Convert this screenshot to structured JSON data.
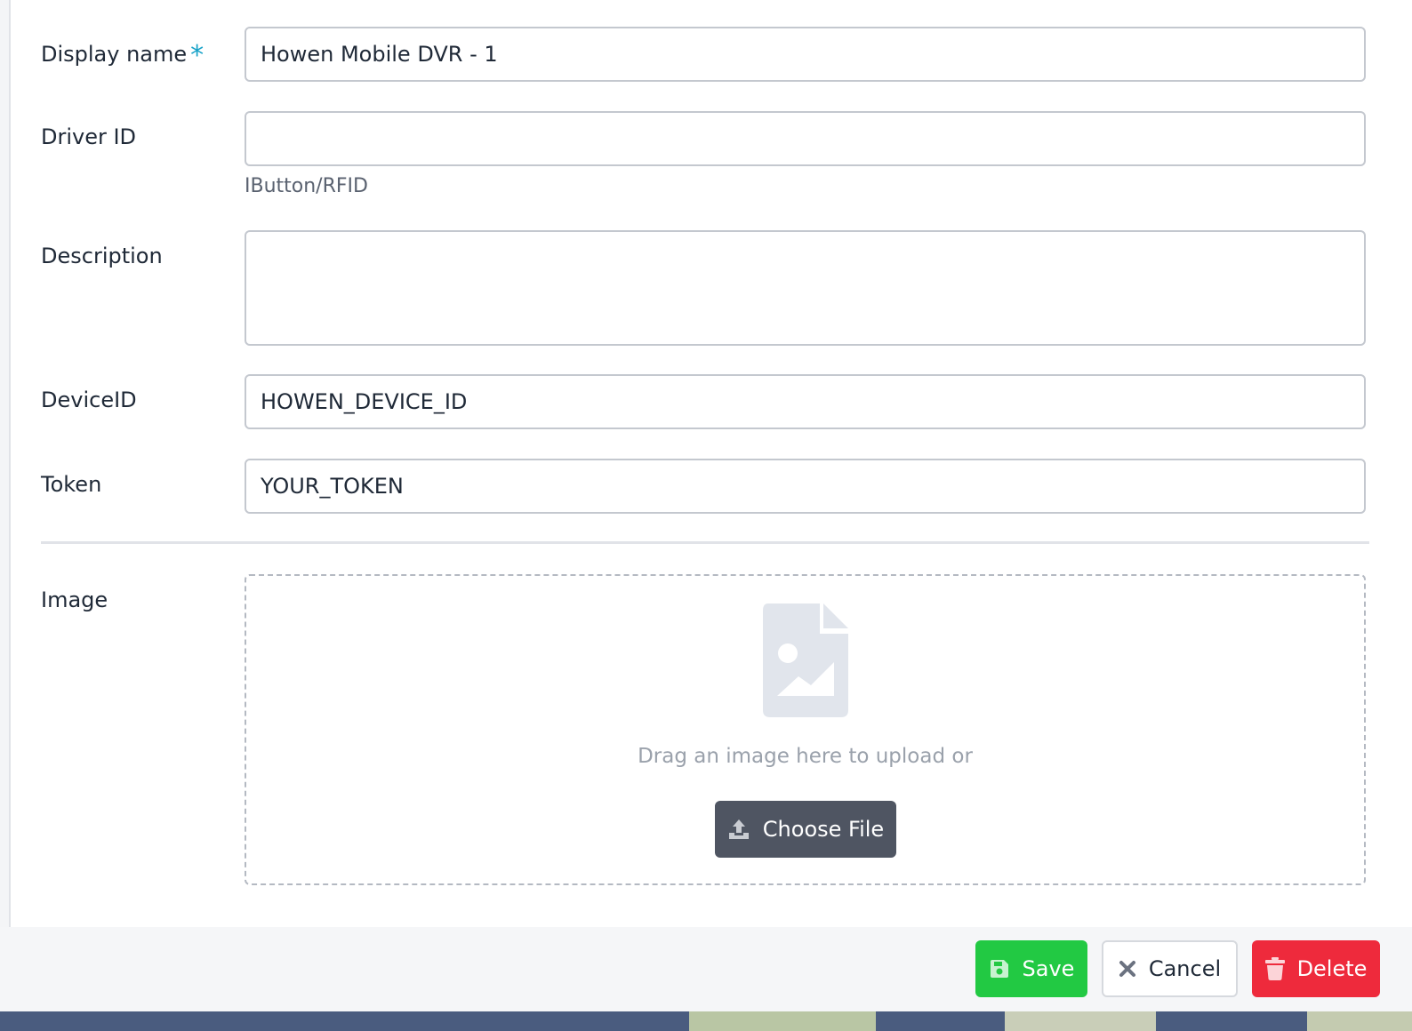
{
  "form": {
    "display_name": {
      "label": "Display name",
      "required_mark": "*",
      "value": "Howen Mobile DVR - 1"
    },
    "driver_id": {
      "label": "Driver ID",
      "value": "",
      "help": "IButton/RFID"
    },
    "description": {
      "label": "Description",
      "value": ""
    },
    "device_id": {
      "label": "DeviceID",
      "value": "HOWEN_DEVICE_ID"
    },
    "token": {
      "label": "Token",
      "value": "YOUR_TOKEN"
    },
    "image": {
      "label": "Image",
      "drop_text": "Drag an image here to upload or",
      "choose_label": "Choose File",
      "icon": "image-file-icon"
    }
  },
  "footer": {
    "save_label": "Save",
    "cancel_label": "Cancel",
    "delete_label": "Delete"
  },
  "colors": {
    "required": "#17a2c8",
    "save": "#22c943",
    "delete": "#ee2a3c",
    "choose_file": "#4f5562"
  }
}
